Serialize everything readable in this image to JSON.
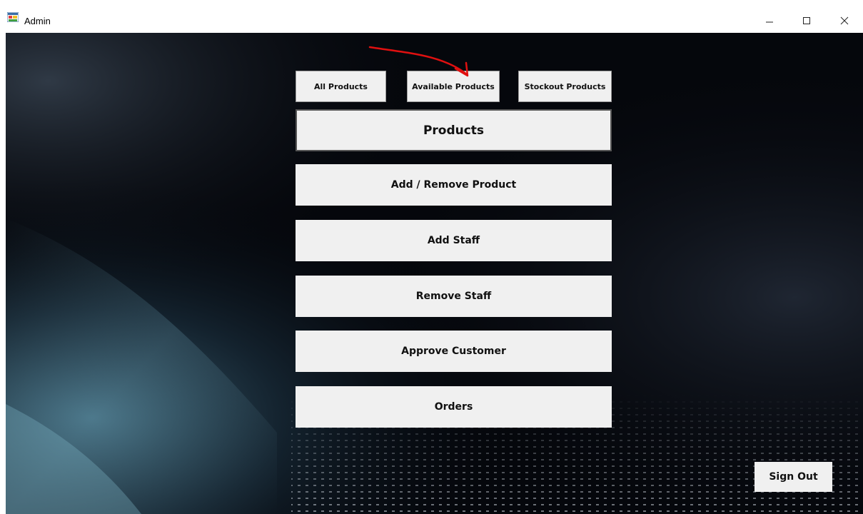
{
  "window": {
    "title": "Admin",
    "app_icon": "winforms-app-icon",
    "minimize_label": "–",
    "maximize_label": "☐",
    "close_label": "✕"
  },
  "filters": {
    "all_products": "All Products",
    "available_products": "Available Products",
    "stockout_products": "Stockout Products"
  },
  "menu": {
    "products": "Products",
    "add_remove_product": "Add / Remove Product",
    "add_staff": "Add Staff",
    "remove_staff": "Remove Staff",
    "approve_customer": "Approve Customer",
    "orders": "Orders"
  },
  "footer": {
    "sign_out": "Sign Out"
  },
  "colors": {
    "button_face": "#f0f0f0",
    "background_dark": "#05070c",
    "annotation_red": "#e01010"
  }
}
